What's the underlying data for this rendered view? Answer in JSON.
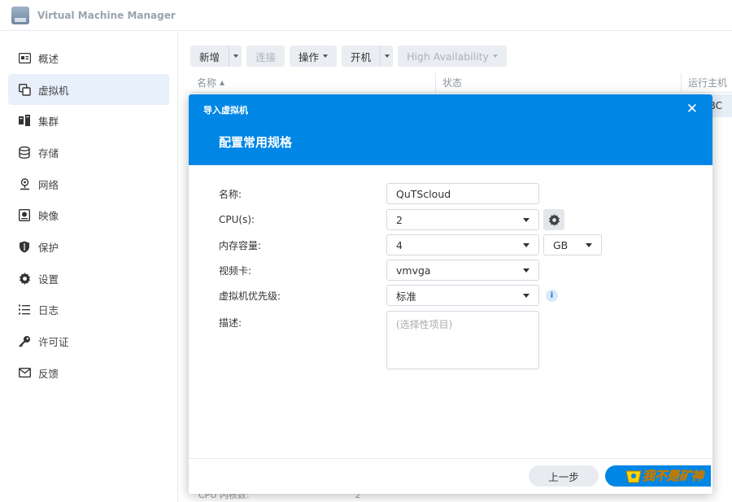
{
  "window": {
    "title": "Virtual Machine Manager",
    "icon": "vmm-app-icon"
  },
  "sidebar": {
    "items": [
      {
        "label": "概述",
        "icon": "overview-icon"
      },
      {
        "label": "虚拟机",
        "icon": "virtual-machine-icon",
        "active": true
      },
      {
        "label": "集群",
        "icon": "cluster-icon"
      },
      {
        "label": "存储",
        "icon": "storage-icon"
      },
      {
        "label": "网络",
        "icon": "network-icon"
      },
      {
        "label": "映像",
        "icon": "image-icon"
      },
      {
        "label": "保护",
        "icon": "shield-icon"
      },
      {
        "label": "设置",
        "icon": "gear-icon"
      },
      {
        "label": "日志",
        "icon": "log-list-icon"
      },
      {
        "label": "许可证",
        "icon": "key-icon"
      },
      {
        "label": "反馈",
        "icon": "mail-icon"
      }
    ]
  },
  "toolbar": {
    "new_label": "新增",
    "connect_label": "连接",
    "action_label": "操作",
    "power_on_label": "开机",
    "ha_label": "High Availability"
  },
  "grid": {
    "columns": [
      "名称",
      "状态",
      "运行主机"
    ],
    "row_peek_text": "BC",
    "footer_peek_label": "CPU 内核数:",
    "footer_peek_value": "2"
  },
  "dialog": {
    "title": "导入虚拟机",
    "step_title": "配置常用规格",
    "close_icon": "close-icon",
    "fields": {
      "name_label": "名称:",
      "name_value": "QuTScloud",
      "cpu_label": "CPU(s):",
      "cpu_value": "2",
      "memory_label": "内存容量:",
      "memory_value": "4",
      "memory_unit": "GB",
      "video_label": "视频卡:",
      "video_value": "vmvga",
      "priority_label": "虚拟机优先级:",
      "priority_value": "标准",
      "desc_label": "描述:",
      "desc_placeholder": "(选择性项目)"
    },
    "buttons": {
      "prev_label": "上一步"
    }
  },
  "watermark": {
    "text": "我不是矿神"
  },
  "colors": {
    "accent": "#0086e5",
    "sidebar_active": "#e7f0fb"
  }
}
